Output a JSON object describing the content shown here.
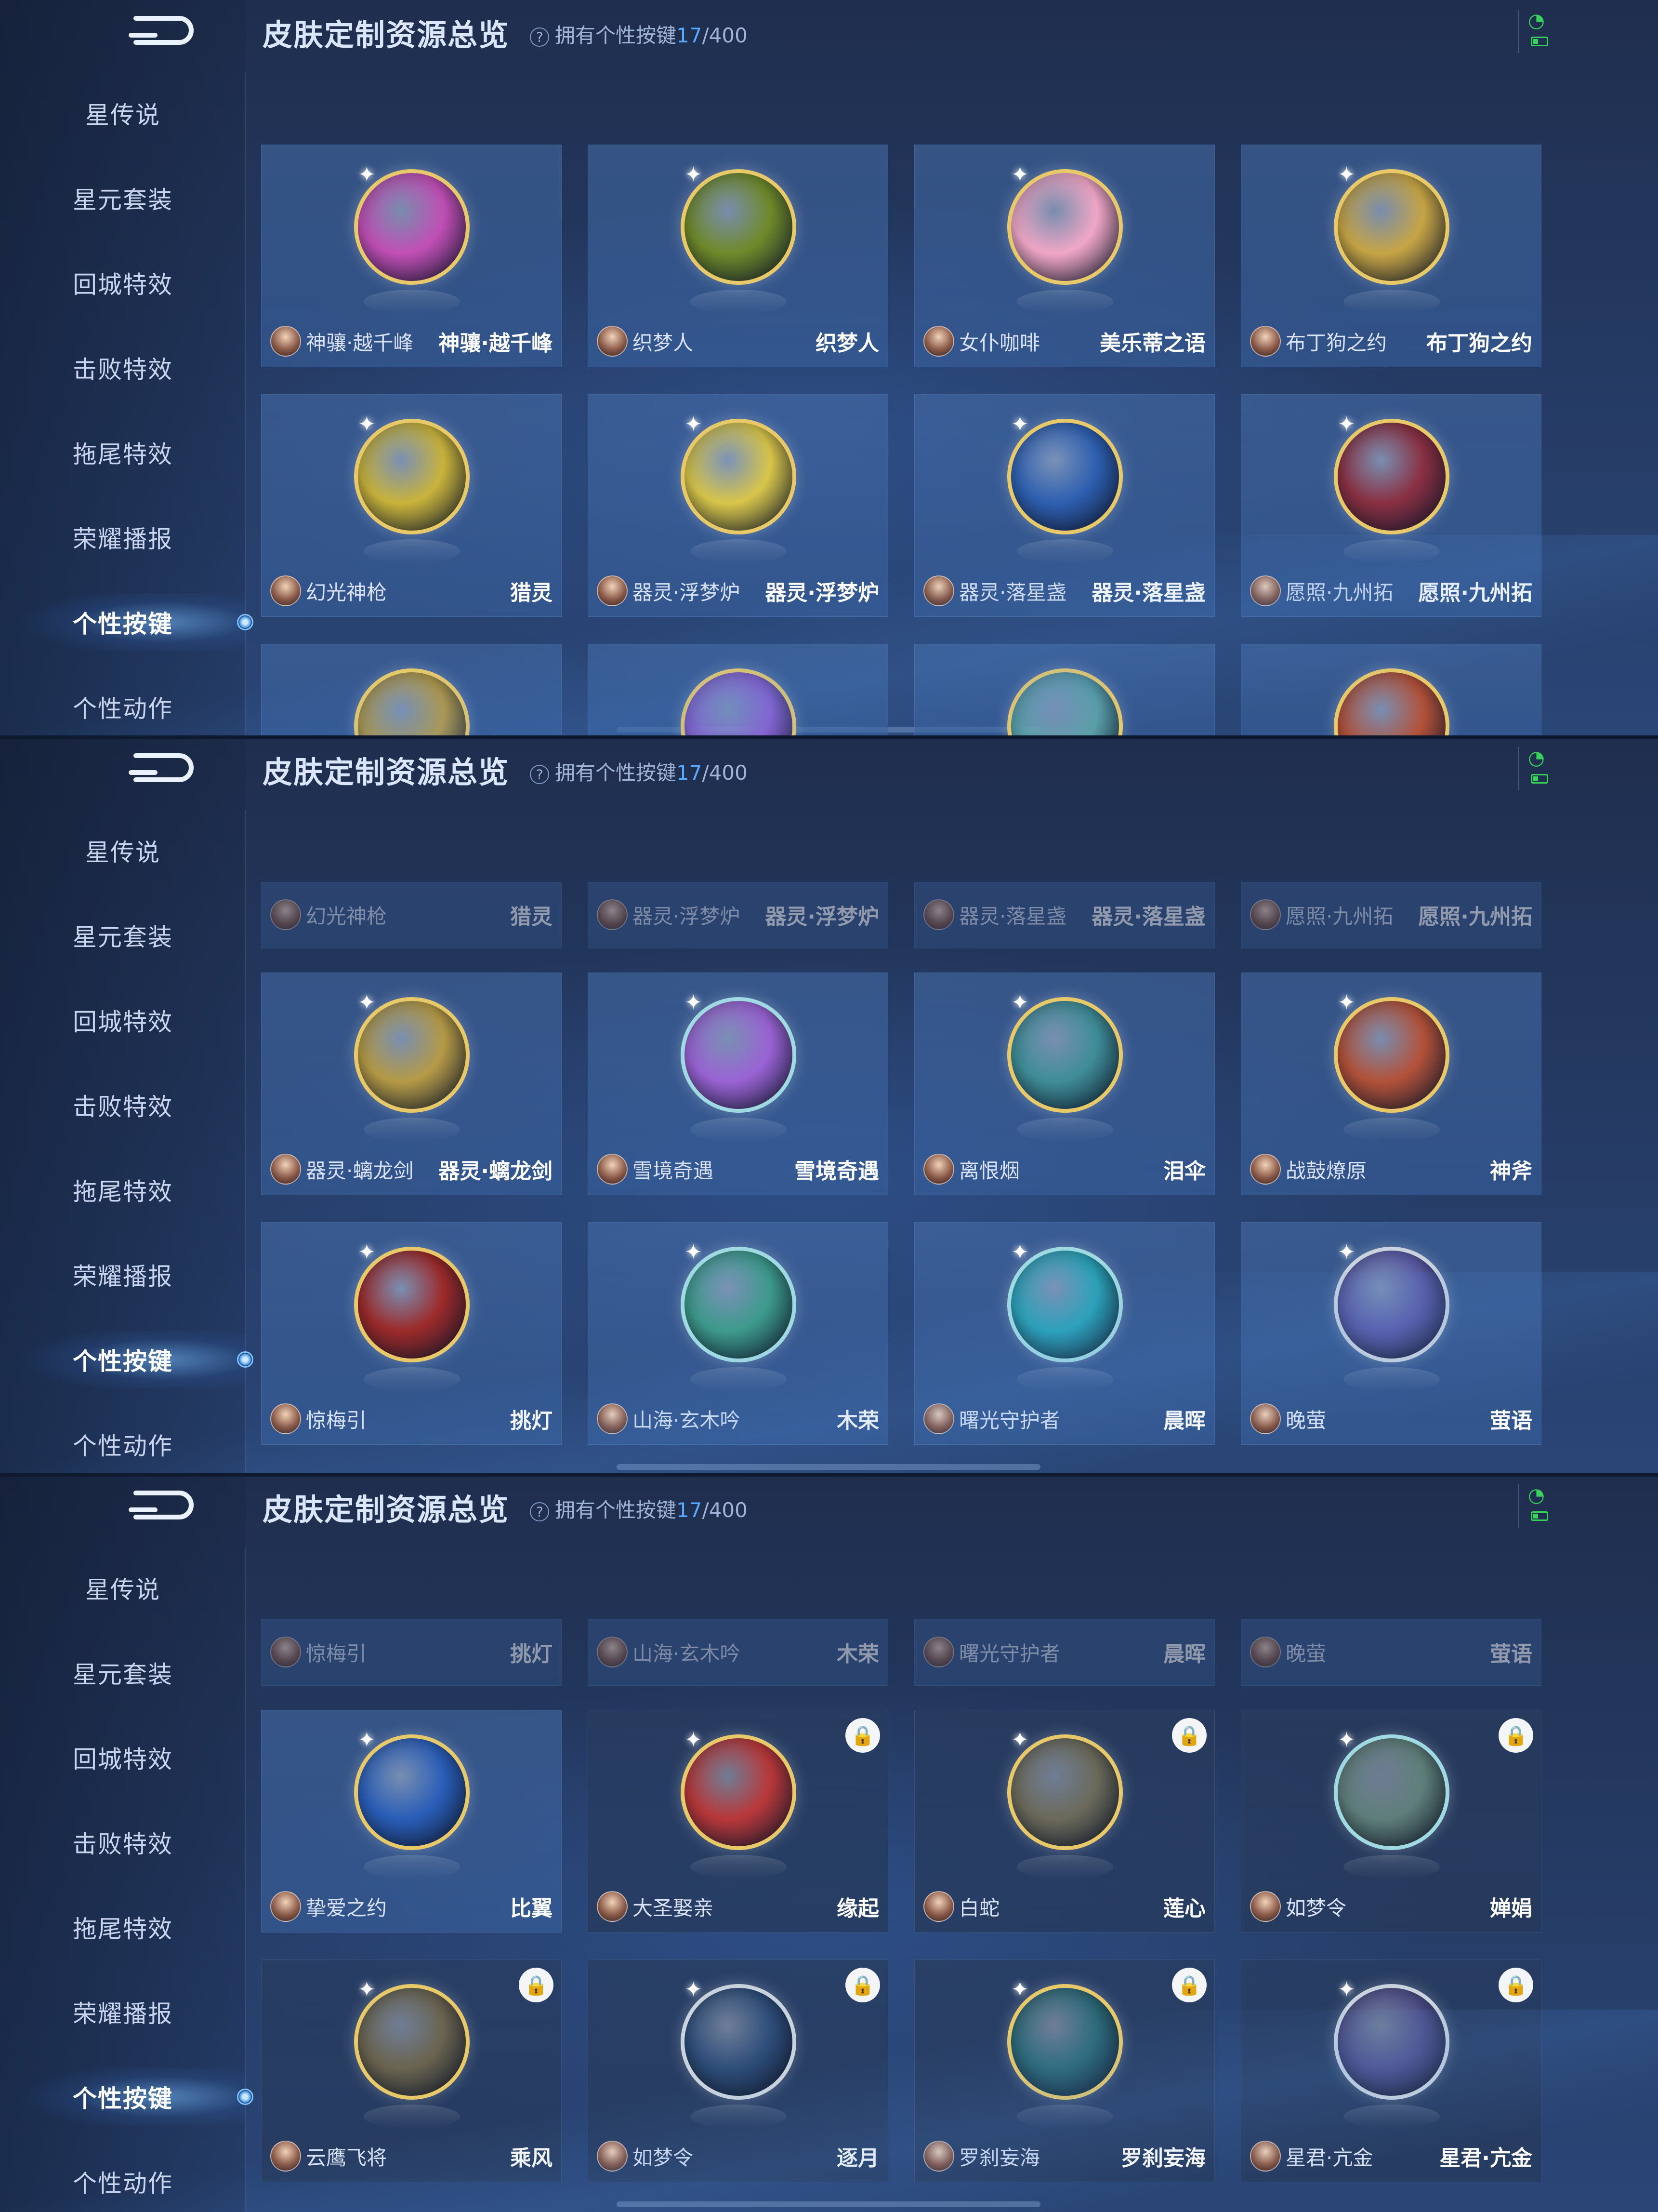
{
  "header": {
    "title": "皮肤定制资源总览",
    "owned_prefix": "拥有个性按键",
    "owned_count": "17",
    "owned_total": "/400",
    "help_icon": "?"
  },
  "sidebar": {
    "items": [
      {
        "label": "星传说"
      },
      {
        "label": "星元套装"
      },
      {
        "label": "回城特效"
      },
      {
        "label": "击败特效"
      },
      {
        "label": "拖尾特效"
      },
      {
        "label": "荣耀播报"
      },
      {
        "label": "个性按键",
        "active": true
      },
      {
        "label": "个性动作"
      }
    ]
  },
  "icons": {
    "lock": "lock-icon",
    "sparkle": "sparkle-icon",
    "back": "back-arrow-icon",
    "wifi": "wifi-icon",
    "battery": "battery-icon"
  },
  "colors": {
    "accent": "#58a8ff",
    "gold_ring": "#e7c96a",
    "status_green": "#36d25a"
  },
  "panels": [
    {
      "cards": [
        {
          "hero": "神骧·越千峰",
          "skin": "神骧·越千峰",
          "icon_color": "#c14fb5",
          "ring": "gold",
          "locked": false
        },
        {
          "hero": "织梦人",
          "skin": "织梦人",
          "icon_color": "#6f8a2a",
          "ring": "gold",
          "locked": false
        },
        {
          "hero": "女仆咖啡",
          "skin": "美乐蒂之语",
          "icon_color": "#f1a7c6",
          "ring": "gold",
          "locked": false
        },
        {
          "hero": "布丁狗之约",
          "skin": "布丁狗之约",
          "icon_color": "#c7a545",
          "ring": "gold",
          "locked": false
        },
        {
          "hero": "幻光神枪",
          "skin": "猎灵",
          "icon_color": "#c9b33b",
          "ring": "gold",
          "locked": false
        },
        {
          "hero": "器灵·浮梦炉",
          "skin": "器灵·浮梦炉",
          "icon_color": "#d8c54a",
          "ring": "gold",
          "locked": false
        },
        {
          "hero": "器灵·落星盏",
          "skin": "器灵·落星盏",
          "icon_color": "#2e5fb0",
          "ring": "gold",
          "locked": false
        },
        {
          "hero": "愿照·九州拓",
          "skin": "愿照·九州拓",
          "icon_color": "#8a3042",
          "ring": "gold",
          "locked": false
        }
      ],
      "partial_row_colors": [
        "#b59a46",
        "#8a5fd0",
        "#5aa0a8",
        "#b3523a"
      ]
    },
    {
      "faded_row": [
        {
          "hero": "幻光神枪",
          "skin": "猎灵"
        },
        {
          "hero": "器灵·浮梦炉",
          "skin": "器灵·浮梦炉"
        },
        {
          "hero": "器灵·落星盏",
          "skin": "器灵·落星盏"
        },
        {
          "hero": "愿照·九州拓",
          "skin": "愿照·九州拓"
        }
      ],
      "cards": [
        {
          "hero": "器灵·螭龙剑",
          "skin": "器灵·螭龙剑",
          "icon_color": "#b59a46",
          "ring": "gold",
          "locked": false
        },
        {
          "hero": "雪境奇遇",
          "skin": "雪境奇遇",
          "icon_color": "#9a63d4",
          "ring": "teal",
          "locked": false
        },
        {
          "hero": "离恨烟",
          "skin": "泪伞",
          "icon_color": "#3f8d97",
          "ring": "gold",
          "locked": false
        },
        {
          "hero": "战鼓燎原",
          "skin": "神斧",
          "icon_color": "#b3523a",
          "ring": "gold",
          "locked": false
        },
        {
          "hero": "惊梅引",
          "skin": "挑灯",
          "icon_color": "#9c2a2a",
          "ring": "gold",
          "locked": false
        },
        {
          "hero": "山海·玄木吟",
          "skin": "木荣",
          "icon_color": "#3d9a8c",
          "ring": "teal",
          "locked": false
        },
        {
          "hero": "曙光守护者",
          "skin": "晨晖",
          "icon_color": "#2aa3b8",
          "ring": "teal",
          "locked": false
        },
        {
          "hero": "晚萤",
          "skin": "萤语",
          "icon_color": "#5a5aa6",
          "ring": "silver",
          "locked": false
        }
      ]
    },
    {
      "faded_row": [
        {
          "hero": "惊梅引",
          "skin": "挑灯"
        },
        {
          "hero": "山海·玄木吟",
          "skin": "木荣"
        },
        {
          "hero": "曙光守护者",
          "skin": "晨晖"
        },
        {
          "hero": "晚萤",
          "skin": "萤语"
        }
      ],
      "cards": [
        {
          "hero": "挚爱之约",
          "skin": "比翼",
          "icon_color": "#2a5eb8",
          "ring": "gold",
          "locked": false
        },
        {
          "hero": "大圣娶亲",
          "skin": "缘起",
          "icon_color": "#b8383a",
          "ring": "gold",
          "locked": true
        },
        {
          "hero": "白蛇",
          "skin": "莲心",
          "icon_color": "#6b6a5a",
          "ring": "gold",
          "locked": true
        },
        {
          "hero": "如梦令",
          "skin": "婵娟",
          "icon_color": "#5f7f7a",
          "ring": "teal",
          "locked": true
        },
        {
          "hero": "云鹰飞将",
          "skin": "乘风",
          "icon_color": "#6a6450",
          "ring": "gold",
          "locked": true
        },
        {
          "hero": "如梦令",
          "skin": "逐月",
          "icon_color": "#2e4e7a",
          "ring": "silver",
          "locked": true
        },
        {
          "hero": "罗刹妄海",
          "skin": "罗刹妄海",
          "icon_color": "#2d6a78",
          "ring": "gold",
          "locked": true
        },
        {
          "hero": "星君·亢金",
          "skin": "星君·亢金",
          "icon_color": "#4f4f8a",
          "ring": "silver",
          "locked": true
        }
      ]
    }
  ]
}
